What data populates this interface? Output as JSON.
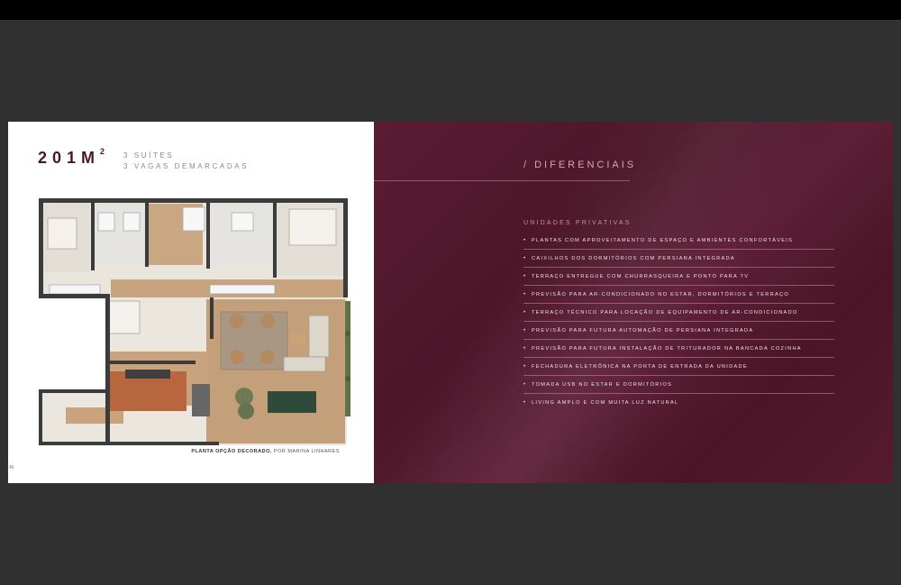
{
  "left_page": {
    "unit_size": "201M",
    "unit_size_sup": "2",
    "specs": [
      "3 SUÍTES",
      "3 VAGAS DEMARCADAS"
    ],
    "caption_bold": "PLANTA OPÇÃO DECORADO,",
    "caption_rest": " POR MARINA LINHARES",
    "page_number": "46"
  },
  "right_page": {
    "title": "/ DIFERENCIAIS",
    "section_label": "UNIDADES PRIVATIVAS",
    "bullet": "•",
    "features": [
      "PLANTAS COM APROVEITAMENTO DE ESPAÇO E AMBIENTES CONFORTÁVEIS",
      "CAIXILHOS DOS DORMITÓRIOS COM PERSIANA INTEGRADA",
      "TERRAÇO ENTREGUE COM CHURRASQUEIRA E PONTO PARA TV",
      "PREVISÃO PARA AR-CONDICIONADO NO ESTAR, DORMITÓRIOS E TERRAÇO",
      "TERRAÇO TÉCNICO PARA LOCAÇÃO DE EQUIPAMENTO DE AR-CONDICIONADO",
      "PREVISÃO PARA FUTURA AUTOMAÇÃO DE PERSIANA INTEGRADA",
      "PREVISÃO PARA FUTURA INSTALAÇÃO DE TRITURADOR NA BANCADA COZINHA",
      "FECHADURA ELETRÔNICA NA PORTA DE ENTRADA DA UNIDADE",
      "TOMADA USB NO ESTAR E DORMITÓRIOS",
      "LIVING AMPLO E COM MUITA LUZ NATURAL"
    ]
  },
  "colors": {
    "background": "#303030",
    "burgundy": "#4d1629",
    "title_text": "#4a1729",
    "accent_pink": "#d9a6b4"
  }
}
